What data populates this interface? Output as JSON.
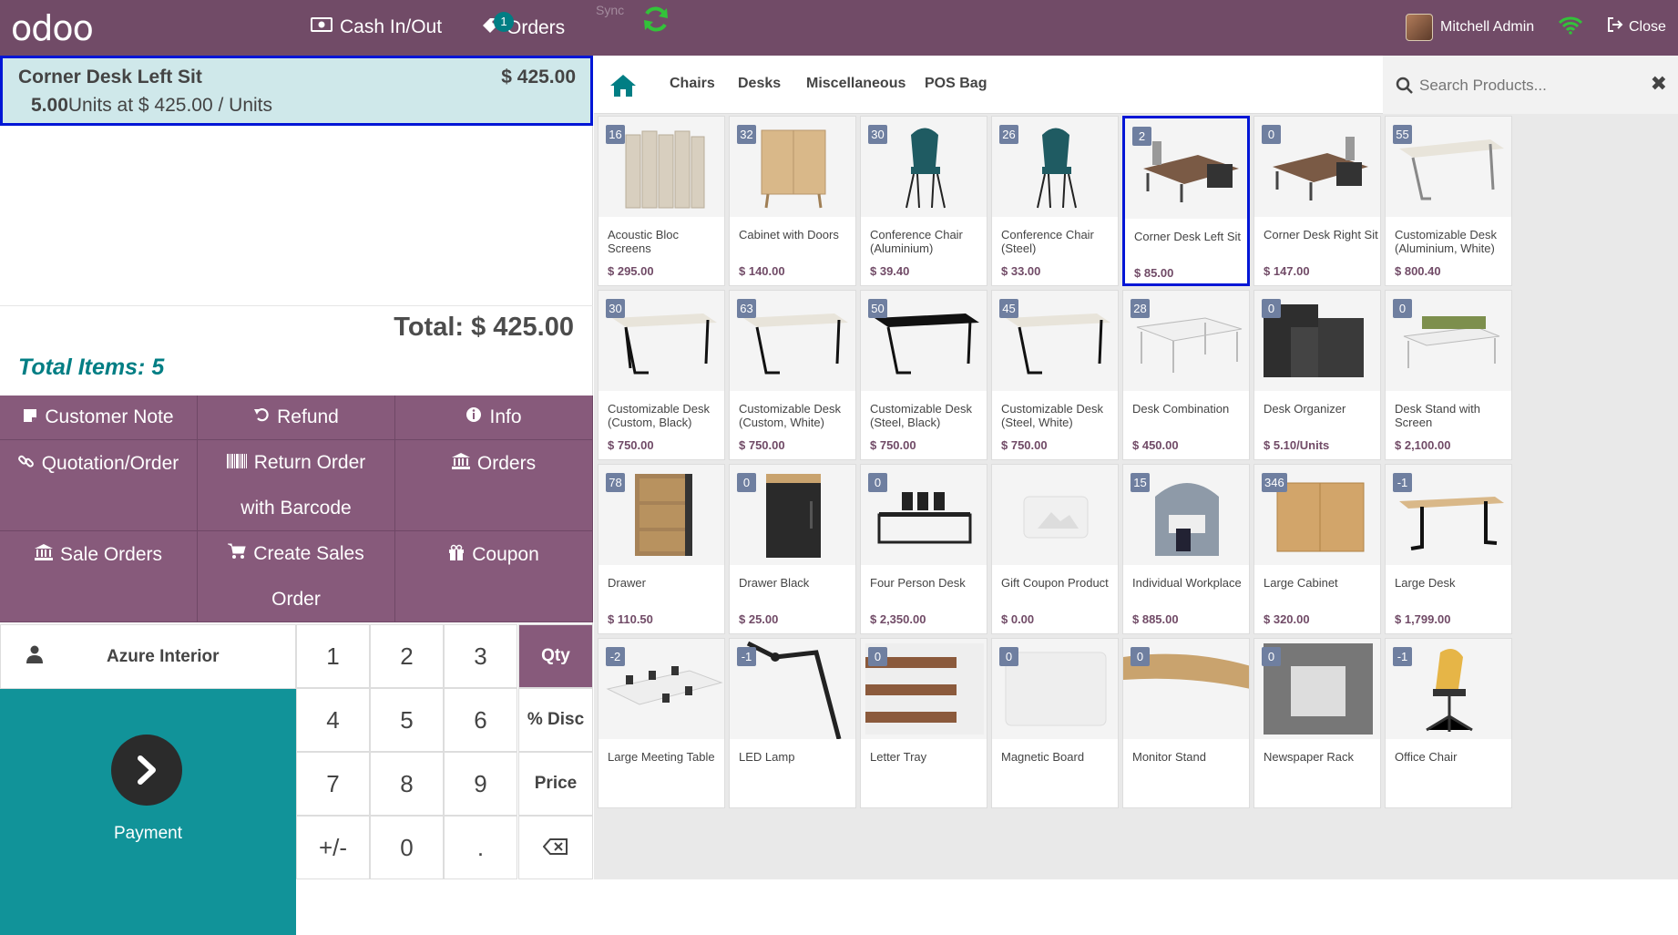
{
  "topbar": {
    "logo": "odoo",
    "cash_label": "Cash In/Out",
    "orders_label": "Orders",
    "orders_badge": "1",
    "sync_label": "Sync",
    "user_name": "Mitchell Admin",
    "close_label": "Close"
  },
  "order": {
    "line_name": "Corner Desk Left Sit",
    "line_price": "$ 425.00",
    "line_qty": "5.00",
    "line_detail": "Units at $ 425.00 / Units",
    "total": "Total: $ 425.00",
    "total_items": "Total Items: 5"
  },
  "controls": {
    "customer_note": "Customer Note",
    "refund": "Refund",
    "info": "Info",
    "quotation": "Quotation/Order",
    "return_order_1": "Return Order",
    "return_order_2": "with Barcode",
    "orders": "Orders",
    "sale_orders": "Sale Orders",
    "create_sales_1": "Create Sales",
    "create_sales_2": "Order",
    "coupon": "Coupon"
  },
  "numpad": {
    "customer": "Azure Interior",
    "payment": "Payment",
    "keys": [
      "1",
      "2",
      "3",
      "4",
      "5",
      "6",
      "7",
      "8",
      "9",
      "+/-",
      "0",
      "."
    ],
    "qty": "Qty",
    "disc": "% Disc",
    "price": "Price"
  },
  "categories": {
    "items": [
      "Chairs",
      "Desks",
      "Miscellaneous",
      "POS Bag"
    ],
    "search_placeholder": "Search Products..."
  },
  "products": [
    {
      "qty": "16",
      "name": "Acoustic Bloc Screens",
      "price": "$ 295.00"
    },
    {
      "qty": "32",
      "name": "Cabinet with Doors",
      "price": "$ 140.00"
    },
    {
      "qty": "30",
      "name": "Conference Chair (Aluminium)",
      "price": "$ 39.40"
    },
    {
      "qty": "26",
      "name": "Conference Chair (Steel)",
      "price": "$ 33.00"
    },
    {
      "qty": "2",
      "name": "Corner Desk Left Sit",
      "price": "$ 85.00"
    },
    {
      "qty": "0",
      "name": "Corner Desk Right Sit",
      "price": "$ 147.00"
    },
    {
      "qty": "55",
      "name": "Customizable Desk (Aluminium, White)",
      "price": "$ 800.40"
    },
    {
      "qty": "30",
      "name": "Customizable Desk (Custom, Black)",
      "price": "$ 750.00"
    },
    {
      "qty": "63",
      "name": "Customizable Desk (Custom, White)",
      "price": "$ 750.00"
    },
    {
      "qty": "50",
      "name": "Customizable Desk (Steel, Black)",
      "price": "$ 750.00"
    },
    {
      "qty": "45",
      "name": "Customizable Desk (Steel, White)",
      "price": "$ 750.00"
    },
    {
      "qty": "28",
      "name": "Desk Combination",
      "price": "$ 450.00"
    },
    {
      "qty": "0",
      "name": "Desk Organizer",
      "price": "$ 5.10/Units"
    },
    {
      "qty": "0",
      "name": "Desk Stand with Screen",
      "price": "$ 2,100.00"
    },
    {
      "qty": "78",
      "name": "Drawer",
      "price": "$ 110.50"
    },
    {
      "qty": "0",
      "name": "Drawer Black",
      "price": "$ 25.00"
    },
    {
      "qty": "0",
      "name": "Four Person Desk",
      "price": "$ 2,350.00"
    },
    {
      "qty": "",
      "name": "Gift Coupon Product",
      "price": "$ 0.00"
    },
    {
      "qty": "15",
      "name": "Individual Workplace",
      "price": "$ 885.00"
    },
    {
      "qty": "346",
      "name": "Large Cabinet",
      "price": "$ 320.00"
    },
    {
      "qty": "-1",
      "name": "Large Desk",
      "price": "$ 1,799.00"
    },
    {
      "qty": "-2",
      "name": "Large Meeting Table",
      "price": ""
    },
    {
      "qty": "-1",
      "name": "LED Lamp",
      "price": ""
    },
    {
      "qty": "0",
      "name": "Letter Tray",
      "price": ""
    },
    {
      "qty": "0",
      "name": "Magnetic Board",
      "price": ""
    },
    {
      "qty": "0",
      "name": "Monitor Stand",
      "price": ""
    },
    {
      "qty": "0",
      "name": "Newspaper Rack",
      "price": ""
    },
    {
      "qty": "-1",
      "name": "Office Chair",
      "price": ""
    }
  ],
  "selected_product_index": 4,
  "colors": {
    "brand": "#714B67",
    "button": "#875A7B",
    "payment": "#119399",
    "selection": "#0016d6",
    "accent": "#017e84"
  }
}
